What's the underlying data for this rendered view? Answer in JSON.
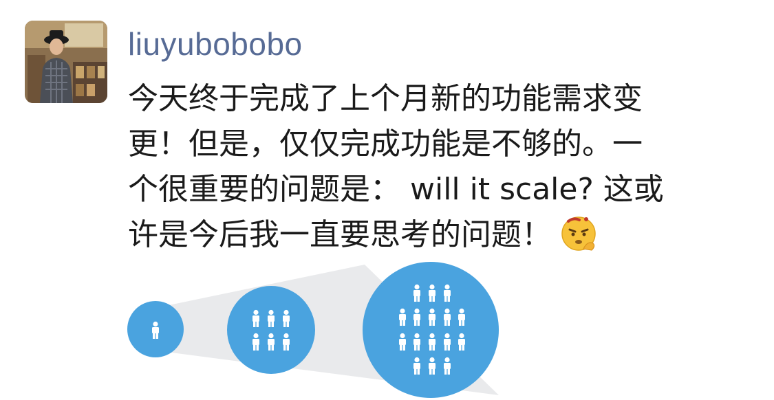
{
  "post": {
    "author": "liuyubobobo",
    "avatar_icon": "user-photo-avatar",
    "text_lines": [
      "今天终于完成了上个月新的功能需求变",
      "更！但是，仅仅完成功能是不够的。一",
      "个很重要的问题是： will it scale? 这或",
      "许是今后我一直要思考的问题！"
    ],
    "emoji": "thinking-face-emoji",
    "colors": {
      "username": "#576b95",
      "text": "#1a1a1a",
      "circle_fill": "#4aa3df",
      "cone_fill": "#e9eaec",
      "person_fill": "#ffffff"
    }
  }
}
